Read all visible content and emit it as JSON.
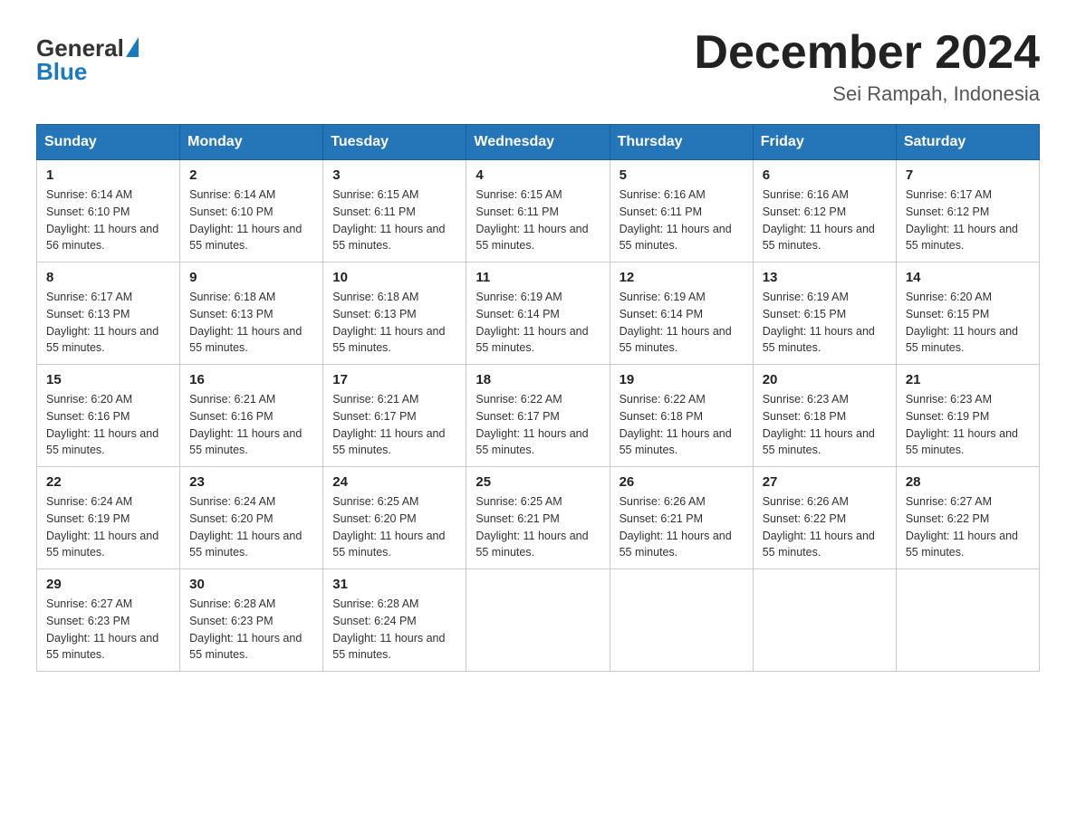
{
  "logo": {
    "general": "General",
    "blue": "Blue"
  },
  "header": {
    "month_year": "December 2024",
    "location": "Sei Rampah, Indonesia"
  },
  "weekdays": [
    "Sunday",
    "Monday",
    "Tuesday",
    "Wednesday",
    "Thursday",
    "Friday",
    "Saturday"
  ],
  "weeks": [
    [
      {
        "day": "1",
        "sunrise": "6:14 AM",
        "sunset": "6:10 PM",
        "daylight": "11 hours and 56 minutes."
      },
      {
        "day": "2",
        "sunrise": "6:14 AM",
        "sunset": "6:10 PM",
        "daylight": "11 hours and 55 minutes."
      },
      {
        "day": "3",
        "sunrise": "6:15 AM",
        "sunset": "6:11 PM",
        "daylight": "11 hours and 55 minutes."
      },
      {
        "day": "4",
        "sunrise": "6:15 AM",
        "sunset": "6:11 PM",
        "daylight": "11 hours and 55 minutes."
      },
      {
        "day": "5",
        "sunrise": "6:16 AM",
        "sunset": "6:11 PM",
        "daylight": "11 hours and 55 minutes."
      },
      {
        "day": "6",
        "sunrise": "6:16 AM",
        "sunset": "6:12 PM",
        "daylight": "11 hours and 55 minutes."
      },
      {
        "day": "7",
        "sunrise": "6:17 AM",
        "sunset": "6:12 PM",
        "daylight": "11 hours and 55 minutes."
      }
    ],
    [
      {
        "day": "8",
        "sunrise": "6:17 AM",
        "sunset": "6:13 PM",
        "daylight": "11 hours and 55 minutes."
      },
      {
        "day": "9",
        "sunrise": "6:18 AM",
        "sunset": "6:13 PM",
        "daylight": "11 hours and 55 minutes."
      },
      {
        "day": "10",
        "sunrise": "6:18 AM",
        "sunset": "6:13 PM",
        "daylight": "11 hours and 55 minutes."
      },
      {
        "day": "11",
        "sunrise": "6:19 AM",
        "sunset": "6:14 PM",
        "daylight": "11 hours and 55 minutes."
      },
      {
        "day": "12",
        "sunrise": "6:19 AM",
        "sunset": "6:14 PM",
        "daylight": "11 hours and 55 minutes."
      },
      {
        "day": "13",
        "sunrise": "6:19 AM",
        "sunset": "6:15 PM",
        "daylight": "11 hours and 55 minutes."
      },
      {
        "day": "14",
        "sunrise": "6:20 AM",
        "sunset": "6:15 PM",
        "daylight": "11 hours and 55 minutes."
      }
    ],
    [
      {
        "day": "15",
        "sunrise": "6:20 AM",
        "sunset": "6:16 PM",
        "daylight": "11 hours and 55 minutes."
      },
      {
        "day": "16",
        "sunrise": "6:21 AM",
        "sunset": "6:16 PM",
        "daylight": "11 hours and 55 minutes."
      },
      {
        "day": "17",
        "sunrise": "6:21 AM",
        "sunset": "6:17 PM",
        "daylight": "11 hours and 55 minutes."
      },
      {
        "day": "18",
        "sunrise": "6:22 AM",
        "sunset": "6:17 PM",
        "daylight": "11 hours and 55 minutes."
      },
      {
        "day": "19",
        "sunrise": "6:22 AM",
        "sunset": "6:18 PM",
        "daylight": "11 hours and 55 minutes."
      },
      {
        "day": "20",
        "sunrise": "6:23 AM",
        "sunset": "6:18 PM",
        "daylight": "11 hours and 55 minutes."
      },
      {
        "day": "21",
        "sunrise": "6:23 AM",
        "sunset": "6:19 PM",
        "daylight": "11 hours and 55 minutes."
      }
    ],
    [
      {
        "day": "22",
        "sunrise": "6:24 AM",
        "sunset": "6:19 PM",
        "daylight": "11 hours and 55 minutes."
      },
      {
        "day": "23",
        "sunrise": "6:24 AM",
        "sunset": "6:20 PM",
        "daylight": "11 hours and 55 minutes."
      },
      {
        "day": "24",
        "sunrise": "6:25 AM",
        "sunset": "6:20 PM",
        "daylight": "11 hours and 55 minutes."
      },
      {
        "day": "25",
        "sunrise": "6:25 AM",
        "sunset": "6:21 PM",
        "daylight": "11 hours and 55 minutes."
      },
      {
        "day": "26",
        "sunrise": "6:26 AM",
        "sunset": "6:21 PM",
        "daylight": "11 hours and 55 minutes."
      },
      {
        "day": "27",
        "sunrise": "6:26 AM",
        "sunset": "6:22 PM",
        "daylight": "11 hours and 55 minutes."
      },
      {
        "day": "28",
        "sunrise": "6:27 AM",
        "sunset": "6:22 PM",
        "daylight": "11 hours and 55 minutes."
      }
    ],
    [
      {
        "day": "29",
        "sunrise": "6:27 AM",
        "sunset": "6:23 PM",
        "daylight": "11 hours and 55 minutes."
      },
      {
        "day": "30",
        "sunrise": "6:28 AM",
        "sunset": "6:23 PM",
        "daylight": "11 hours and 55 minutes."
      },
      {
        "day": "31",
        "sunrise": "6:28 AM",
        "sunset": "6:24 PM",
        "daylight": "11 hours and 55 minutes."
      },
      null,
      null,
      null,
      null
    ]
  ]
}
